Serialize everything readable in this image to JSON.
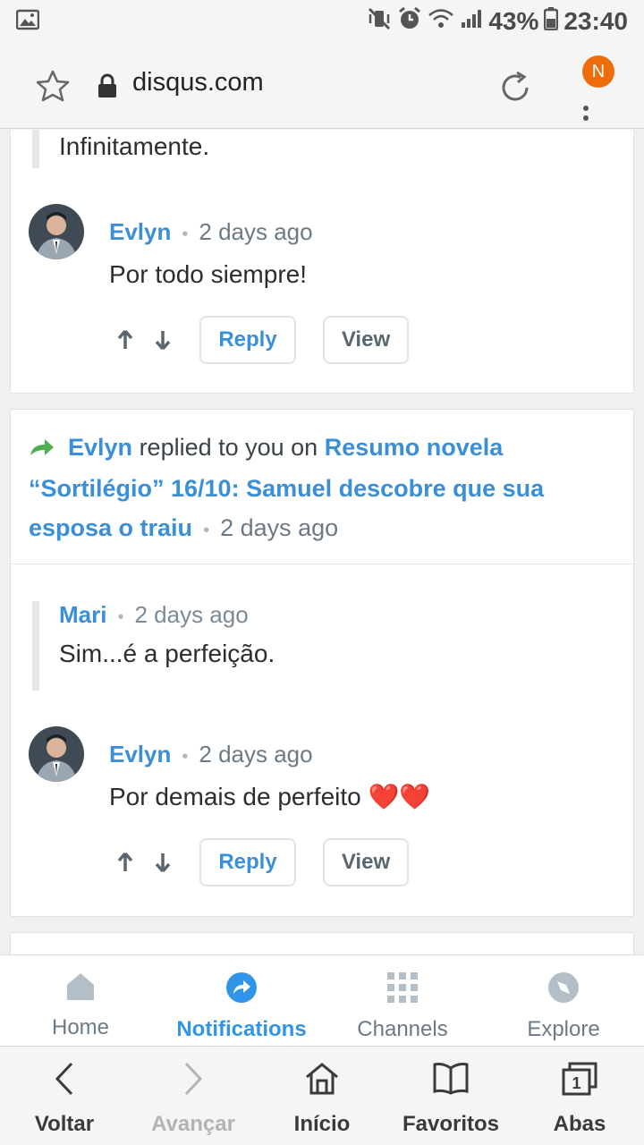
{
  "status_bar": {
    "battery": "43%",
    "time": "23:40"
  },
  "address_bar": {
    "url": "disqus.com",
    "notification_badge": "N"
  },
  "feed": {
    "card1": {
      "quote_text": "Infinitamente.",
      "comment": {
        "author": "Evlyn",
        "time": "2 days ago",
        "text": "Por todo siempre!"
      },
      "reply_label": "Reply",
      "view_label": "View"
    },
    "card2": {
      "header": {
        "actor": "Evlyn",
        "action": "replied to you on",
        "thread_title": "Resumo novela “Sortilégio” 16/10: Samuel descobre que sua esposa o traiu",
        "time": "2 days ago"
      },
      "quote": {
        "author": "Mari",
        "time": "2 days ago",
        "text": "Sim...é a perfeição."
      },
      "comment": {
        "author": "Evlyn",
        "time": "2 days ago",
        "text": "Por demais de perfeito ❤️❤️"
      },
      "reply_label": "Reply",
      "view_label": "View"
    }
  },
  "bottom_tabs": [
    {
      "label": "Home",
      "icon": "home-icon"
    },
    {
      "label": "Notifications",
      "icon": "share-icon",
      "active": true
    },
    {
      "label": "Channels",
      "icon": "grid-icon"
    },
    {
      "label": "Explore",
      "icon": "compass-icon"
    }
  ],
  "browser_nav": [
    {
      "label": "Voltar",
      "icon": "back-icon"
    },
    {
      "label": "Avançar",
      "icon": "forward-icon",
      "disabled": true
    },
    {
      "label": "Início",
      "icon": "home-icon"
    },
    {
      "label": "Favoritos",
      "icon": "bookmarks-icon"
    },
    {
      "label": "Abas",
      "icon": "tabs-icon"
    }
  ],
  "colors": {
    "link": "#3a8fd6",
    "accent_tab": "#2f95e8",
    "badge": "#ef6c0b",
    "reply_arrow": "#4caf50"
  }
}
